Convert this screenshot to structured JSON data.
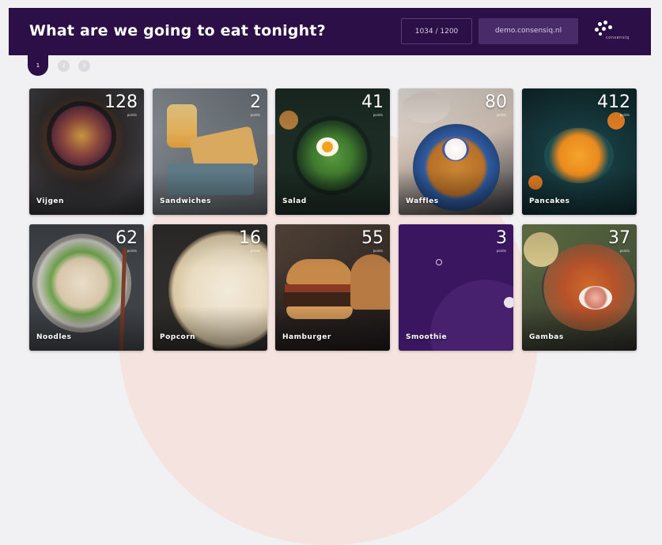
{
  "header": {
    "title": "What are we going to eat tonight?",
    "counter": "1034 / 1200",
    "url": "demo.consensiq.nl",
    "logo_text": "consensiq"
  },
  "tabs": [
    {
      "label": "1",
      "active": true
    },
    {
      "label": "2",
      "active": false
    },
    {
      "label": "3",
      "active": false
    }
  ],
  "colors": {
    "header": "#2b0f46",
    "smoothie_tile": "#3b1660",
    "accent_circle": "#f7d9cf"
  },
  "options": [
    {
      "label": "Vijgen",
      "votes": "128",
      "unit": "points"
    },
    {
      "label": "Sandwiches",
      "votes": "2",
      "unit": "points"
    },
    {
      "label": "Salad",
      "votes": "41",
      "unit": "points"
    },
    {
      "label": "Waffles",
      "votes": "80",
      "unit": "points"
    },
    {
      "label": "Pancakes",
      "votes": "412",
      "unit": "points"
    },
    {
      "label": "Noodles",
      "votes": "62",
      "unit": "points"
    },
    {
      "label": "Popcorn",
      "votes": "16",
      "unit": "points"
    },
    {
      "label": "Hamburger",
      "votes": "55",
      "unit": "points"
    },
    {
      "label": "Smoothie",
      "votes": "3",
      "unit": "points"
    },
    {
      "label": "Gambas",
      "votes": "37",
      "unit": "points"
    }
  ]
}
